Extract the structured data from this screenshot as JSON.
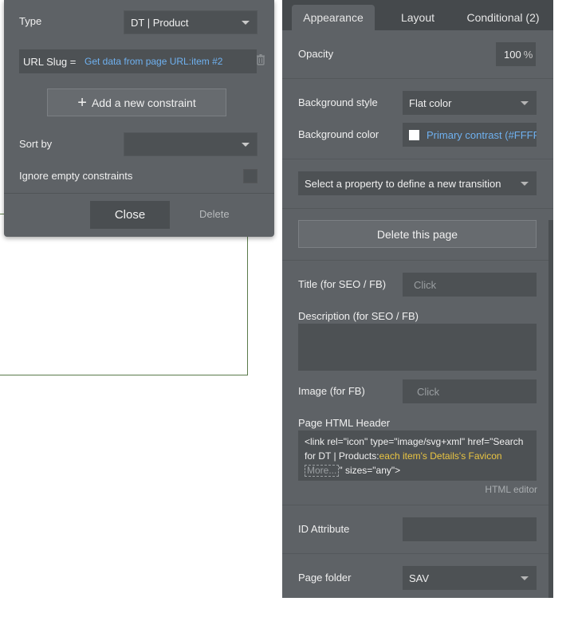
{
  "constraint_popup": {
    "type_label": "Type",
    "type_value": "DT | Product",
    "url_slug_label": "URL Slug =",
    "url_slug_value": "Get data from page URL:item #2",
    "add_constraint_label": "Add a new constraint",
    "sort_by_label": "Sort by",
    "sort_by_value": "",
    "ignore_empty_label": "Ignore empty constraints",
    "close_label": "Close",
    "delete_label": "Delete"
  },
  "property_panel": {
    "tabs": [
      {
        "label": "Appearance",
        "active": true
      },
      {
        "label": "Layout",
        "active": false
      },
      {
        "label": "Conditional (2)",
        "active": false
      }
    ],
    "opacity_label": "Opacity",
    "opacity_value": "100",
    "opacity_unit": "%",
    "bg_style_label": "Background style",
    "bg_style_value": "Flat color",
    "bg_color_label": "Background color",
    "bg_color_value": "Primary contrast (#FFFFFF)",
    "bg_color_swatch": "#FFFFFF",
    "transition_placeholder": "Select a property to define a new transition",
    "delete_page_label": "Delete this page",
    "title_label": "Title (for SEO / FB)",
    "title_placeholder": "Click",
    "description_label": "Description (for SEO / FB)",
    "description_value": "",
    "image_label": "Image (for FB)",
    "image_placeholder": "Click",
    "html_header_label": "Page HTML Header",
    "html_header_text1": "<link rel=\"icon\" type=\"image/svg+xml\" href=\"Search for DT | Products:",
    "html_header_dynamic": "each item's Details's Favicon",
    "html_header_more": "More...",
    "html_header_text2": "\" sizes=\"any\">",
    "html_editor_label": "HTML editor",
    "id_attribute_label": "ID Attribute",
    "id_attribute_value": "",
    "page_folder_label": "Page folder",
    "page_folder_value": "SAV"
  },
  "colors": {
    "panel_bg": "#5e6266",
    "field_bg": "#4d5154",
    "link_blue": "#6fb1f0",
    "dynamic_yellow": "#e9c442"
  },
  "icons": {
    "trash": "trash-icon",
    "plus": "plus-icon",
    "chevron": "chevron-down-icon"
  }
}
